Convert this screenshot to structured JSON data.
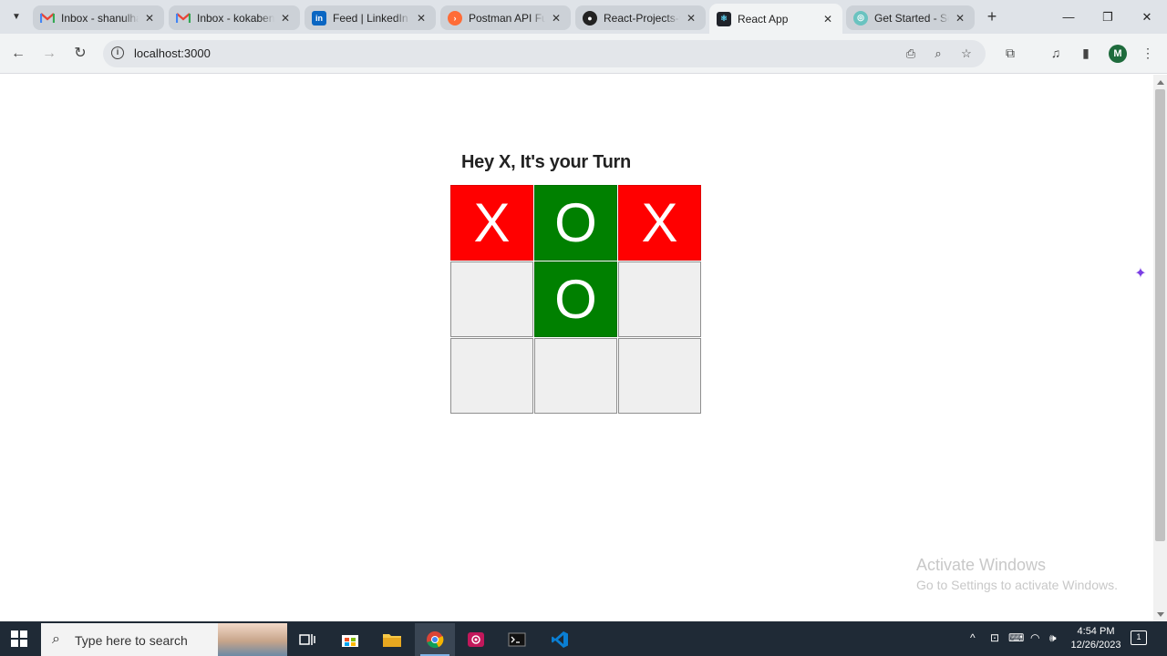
{
  "browser": {
    "tabs": [
      {
        "title": "Inbox - shanulha",
        "favicon": "gmail-icon"
      },
      {
        "title": "Inbox - kokaben",
        "favicon": "gmail-icon"
      },
      {
        "title": "Feed | LinkedIn",
        "favicon": "linkedin-icon"
      },
      {
        "title": "Postman API Fun",
        "favicon": "postman-icon"
      },
      {
        "title": "React-Projects-w",
        "favicon": "github-icon"
      },
      {
        "title": "React App",
        "favicon": "react-icon",
        "active": true
      },
      {
        "title": "Get Started - Se",
        "favicon": "globe-icon"
      }
    ],
    "url": "localhost:3000",
    "profile_initial": "M"
  },
  "game": {
    "status": "Hey X, It's your Turn",
    "board": [
      "X",
      "O",
      "X",
      "",
      "O",
      "",
      "",
      "",
      ""
    ],
    "colors": {
      "x": "#ff0000",
      "o": "#008000",
      "empty": "#efefef"
    }
  },
  "watermark": {
    "line1": "Activate Windows",
    "line2": "Go to Settings to activate Windows."
  },
  "taskbar": {
    "search_placeholder": "Type here to search",
    "time": "4:54 PM",
    "date": "12/26/2023",
    "apps": [
      "task-view-icon",
      "store-icon",
      "file-explorer-icon",
      "chrome-icon",
      "screen-recorder-icon",
      "terminal-icon",
      "vscode-icon"
    ]
  }
}
